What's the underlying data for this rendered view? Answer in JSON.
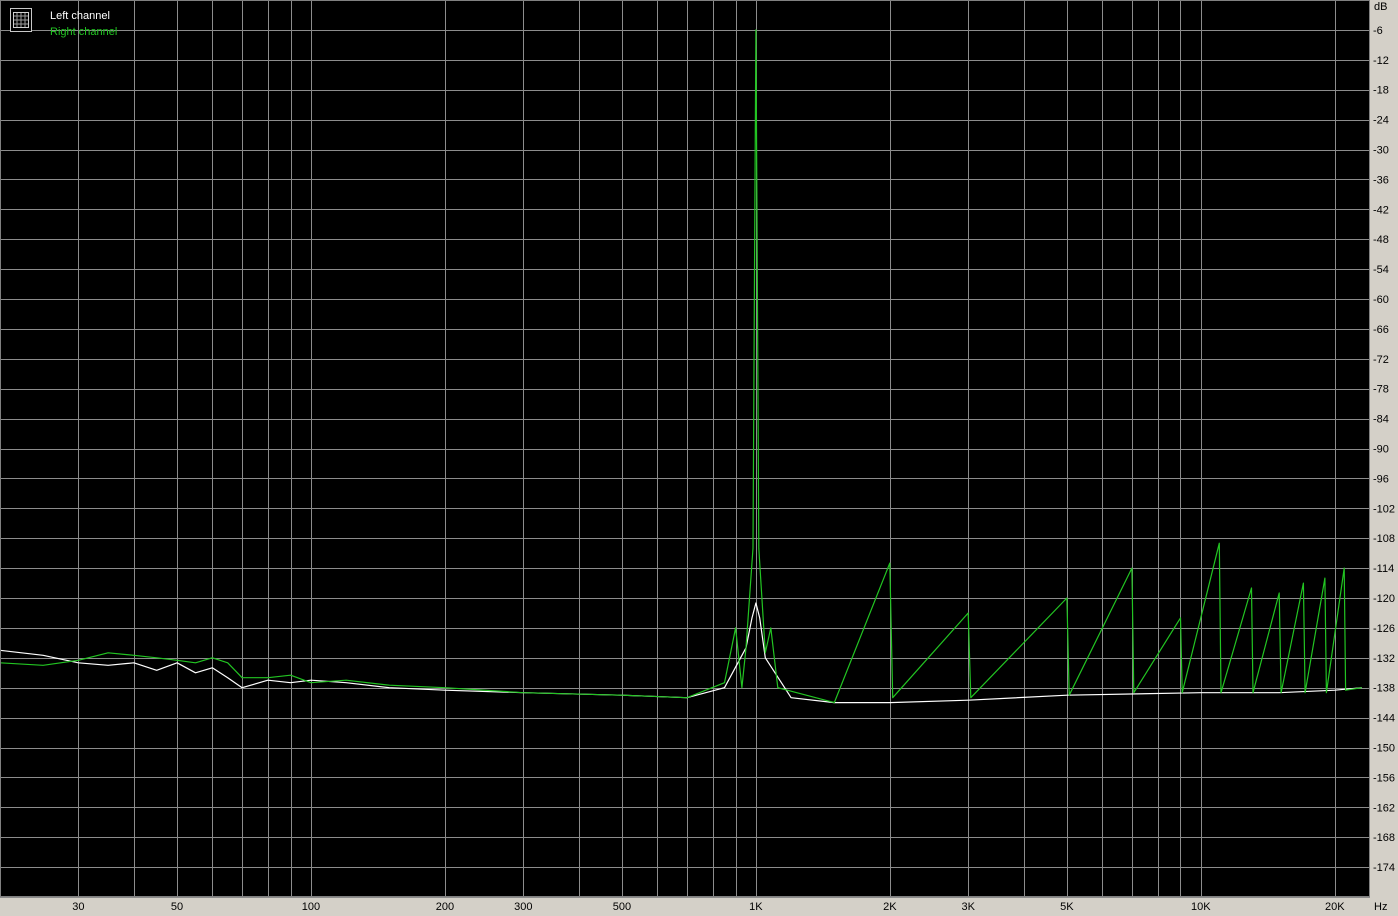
{
  "chart_data": {
    "type": "line",
    "xlabel": "Hz",
    "ylabel": "dB",
    "x_scale": "log",
    "xlim": [
      20,
      24000
    ],
    "ylim": [
      -180,
      0
    ],
    "grid": true,
    "legend_position": "top-left",
    "x_ticks": [
      {
        "value": 30,
        "label": "30"
      },
      {
        "value": 50,
        "label": "50"
      },
      {
        "value": 100,
        "label": "100"
      },
      {
        "value": 200,
        "label": "200"
      },
      {
        "value": 300,
        "label": "300"
      },
      {
        "value": 500,
        "label": "500"
      },
      {
        "value": 1000,
        "label": "1K"
      },
      {
        "value": 2000,
        "label": "2K"
      },
      {
        "value": 3000,
        "label": "3K"
      },
      {
        "value": 5000,
        "label": "5K"
      },
      {
        "value": 10000,
        "label": "10K"
      },
      {
        "value": 20000,
        "label": "20K"
      }
    ],
    "y_ticks": [
      -6,
      -12,
      -18,
      -24,
      -30,
      -36,
      -42,
      -48,
      -54,
      -60,
      -66,
      -72,
      -78,
      -84,
      -90,
      -96,
      -102,
      -108,
      -114,
      -120,
      -126,
      -132,
      -138,
      -144,
      -150,
      -156,
      -162,
      -168,
      -174
    ],
    "series": [
      {
        "name": "Left channel",
        "color": "#ffffff",
        "points": [
          [
            20,
            -130.5
          ],
          [
            25,
            -131.5
          ],
          [
            30,
            -133
          ],
          [
            35,
            -133.5
          ],
          [
            40,
            -133
          ],
          [
            45,
            -134.5
          ],
          [
            50,
            -133
          ],
          [
            55,
            -135
          ],
          [
            60,
            -134
          ],
          [
            65,
            -136
          ],
          [
            70,
            -138
          ],
          [
            80,
            -136.5
          ],
          [
            90,
            -137
          ],
          [
            100,
            -136.5
          ],
          [
            120,
            -137
          ],
          [
            150,
            -138
          ],
          [
            200,
            -138.5
          ],
          [
            300,
            -139
          ],
          [
            500,
            -139.5
          ],
          [
            700,
            -140
          ],
          [
            850,
            -138
          ],
          [
            950,
            -130
          ],
          [
            980,
            -124
          ],
          [
            1000,
            -121
          ],
          [
            1020,
            -124
          ],
          [
            1050,
            -132
          ],
          [
            1200,
            -140
          ],
          [
            1500,
            -141
          ],
          [
            2000,
            -141
          ],
          [
            3000,
            -140.5
          ],
          [
            5000,
            -139.5
          ],
          [
            10000,
            -139
          ],
          [
            15000,
            -139
          ],
          [
            20000,
            -138.5
          ],
          [
            23000,
            -138
          ]
        ]
      },
      {
        "name": "Right channel",
        "color": "#22c422",
        "points": [
          [
            20,
            -133
          ],
          [
            25,
            -133.5
          ],
          [
            30,
            -132.5
          ],
          [
            35,
            -131
          ],
          [
            40,
            -131.5
          ],
          [
            45,
            -132
          ],
          [
            50,
            -132.5
          ],
          [
            55,
            -133
          ],
          [
            60,
            -132
          ],
          [
            65,
            -133
          ],
          [
            70,
            -136
          ],
          [
            80,
            -136
          ],
          [
            90,
            -135.5
          ],
          [
            100,
            -137
          ],
          [
            120,
            -136.5
          ],
          [
            150,
            -137.5
          ],
          [
            200,
            -138
          ],
          [
            300,
            -139
          ],
          [
            500,
            -139.5
          ],
          [
            700,
            -140
          ],
          [
            850,
            -137
          ],
          [
            900,
            -126
          ],
          [
            930,
            -138
          ],
          [
            950,
            -130
          ],
          [
            985,
            -110
          ],
          [
            995,
            -40
          ],
          [
            1000,
            -6
          ],
          [
            1005,
            -40
          ],
          [
            1015,
            -110
          ],
          [
            1050,
            -131
          ],
          [
            1080,
            -126
          ],
          [
            1120,
            -138
          ],
          [
            1500,
            -141
          ],
          [
            2000,
            -113
          ],
          [
            2030,
            -140
          ],
          [
            3000,
            -123
          ],
          [
            3040,
            -140
          ],
          [
            5000,
            -120
          ],
          [
            5060,
            -139.5
          ],
          [
            7000,
            -114
          ],
          [
            7070,
            -139
          ],
          [
            9000,
            -124
          ],
          [
            9080,
            -139
          ],
          [
            11000,
            -109
          ],
          [
            11100,
            -139
          ],
          [
            13000,
            -118
          ],
          [
            13100,
            -139
          ],
          [
            15000,
            -119
          ],
          [
            15150,
            -139
          ],
          [
            17000,
            -117
          ],
          [
            17150,
            -139
          ],
          [
            19000,
            -116
          ],
          [
            19150,
            -139
          ],
          [
            21000,
            -114
          ],
          [
            21150,
            -138.5
          ],
          [
            23000,
            -138
          ]
        ]
      }
    ],
    "peaks": [
      {
        "series": "Right channel",
        "x": 1000,
        "y": -6
      },
      {
        "series": "Right channel",
        "x": 2000,
        "y": -113
      },
      {
        "series": "Right channel",
        "x": 11000,
        "y": -109
      }
    ]
  }
}
